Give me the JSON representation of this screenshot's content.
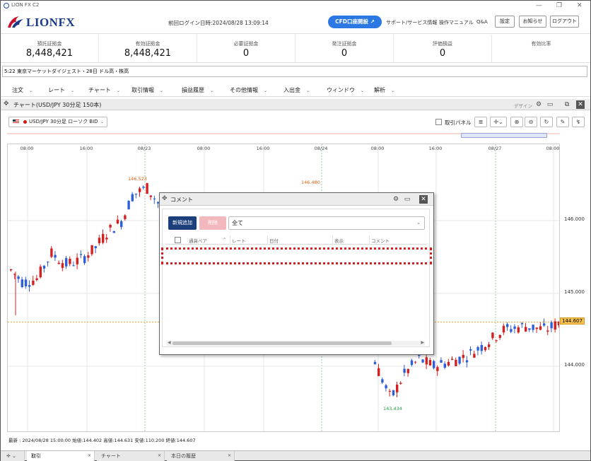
{
  "window": {
    "app_name": "LION FX C2"
  },
  "header": {
    "brand": "LIONFX",
    "last_login": "前回ログイン日時:2024/08/28 13:09:14",
    "cfd_button": "CFD口座開設",
    "links": [
      "サポート/サービス情報",
      "操作マニュアル",
      "Q&A"
    ],
    "buttons": [
      "設定",
      "お知らせ",
      "ログアウト"
    ]
  },
  "stats": [
    {
      "label": "預託証拠金",
      "value": "8,448,421"
    },
    {
      "label": "有効証拠金",
      "value": "8,448,421"
    },
    {
      "label": "必要証拠金",
      "value": "0"
    },
    {
      "label": "発注証拠金",
      "value": "0"
    },
    {
      "label": "評価損益",
      "value": "0"
    },
    {
      "label": "有効比率",
      "value": ""
    }
  ],
  "ticker": "5:22  東京マーケットダイジェスト・28日  ドル高・株高",
  "menu": [
    "注文",
    "レート",
    "チャート",
    "取引情報",
    "損益履歴",
    "その他情報",
    "入出金",
    "ウィンドウ",
    "解析"
  ],
  "chart_window": {
    "title": "チャート(USD/JPY 30分足 150本)",
    "design_label": "デザイン",
    "pair_select": "USD/JPY 30分足 ローソク BID",
    "panel_label": "取引パネル"
  },
  "chart_data": {
    "type": "candlestick",
    "instrument": "USD/JPY",
    "interval": "30分足",
    "time_ticks": [
      "08:00",
      "16:00",
      "08/23",
      "08:00",
      "16:00",
      "08/24",
      "08:00",
      "16:00",
      "08/27",
      "08:00"
    ],
    "price_ticks": [
      "146.000",
      "145.000",
      "144.000"
    ],
    "current_price": "144.607",
    "high_marker": "146.523",
    "high_marker_2": "146.480",
    "low_marker": "143.434",
    "status_line": "最新 : 2024/08/28 15:00:00  始値:144.402  高値:144.631  安値:110.200  終値:144.607"
  },
  "comment_dialog": {
    "title": "コメント",
    "new_button": "新規追加",
    "delete_button": "削除",
    "filter_value": "全て",
    "columns": [
      "通貨ペア",
      "レート",
      "日付",
      "表示",
      "コメント"
    ]
  },
  "bottom_tabs": [
    "取引",
    "チャート",
    "本日の履歴"
  ],
  "colors": {
    "up": "#d42020",
    "down": "#2f5fd8",
    "accent": "#2b78e4"
  }
}
